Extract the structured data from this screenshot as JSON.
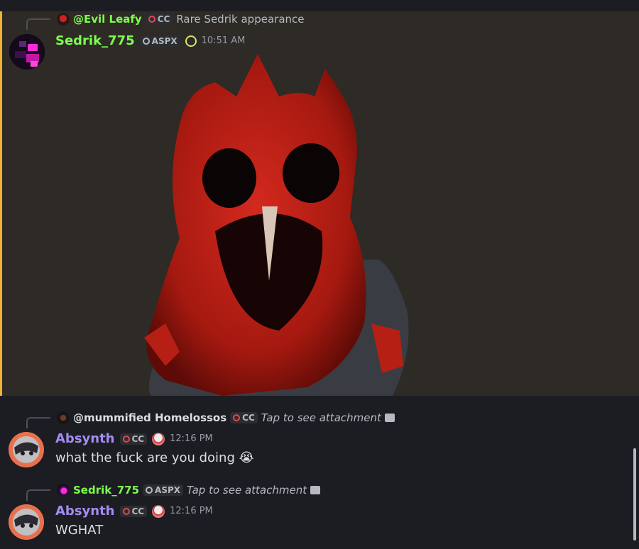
{
  "colors": {
    "highlight_bg": "#2e2a26",
    "highlight_bar": "#f0b232",
    "name_green": "#7cff4d",
    "name_purple": "#a38cf5",
    "app_bg": "#1c1d22"
  },
  "message1": {
    "reply": {
      "author": "@Evil Leafy",
      "tag": "CC",
      "text": "Rare Sedrik appearance"
    },
    "author": "Sedrik_775",
    "tag": "ASPX",
    "time": "10:51 AM"
  },
  "message2": {
    "reply": {
      "author": "@mummified Homelossos",
      "tag": "CC",
      "text": "Tap to see attachment"
    },
    "author": "Absynth",
    "tag": "CC",
    "time": "12:16 PM",
    "text": "what the fuck are you doing",
    "emoji": "😭"
  },
  "message3": {
    "reply": {
      "author": "Sedrik_775",
      "tag": "ASPX",
      "text": "Tap to see attachment"
    },
    "author": "Absynth",
    "tag": "CC",
    "time": "12:16 PM",
    "text": "WGHAT"
  }
}
